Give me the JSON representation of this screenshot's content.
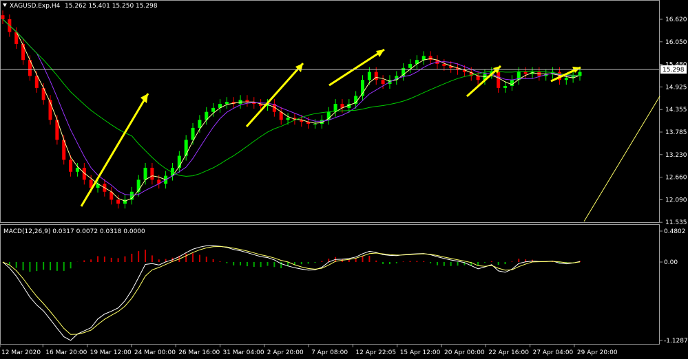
{
  "header": {
    "symbol_label": "XAGUSD.Exp,H4",
    "ohlc": "15.262 15.401 15.250 15.298"
  },
  "price_axis": {
    "ticks": [
      "16.620",
      "16.050",
      "15.480",
      "14.925",
      "14.355",
      "13.785",
      "13.230",
      "12.660",
      "12.090",
      "11.535"
    ],
    "current_price_label": "15.298"
  },
  "macd": {
    "label": "MACD(12,26,9) 0.0317 0.0072 0.0318 0.0000",
    "axis_ticks": [
      "0.4802",
      "0.00",
      "-1.1287"
    ]
  },
  "time_axis": {
    "labels": [
      "12 Mar 2020",
      "16 Mar 20:00",
      "19 Mar 12:00",
      "24 Mar 00:00",
      "26 Mar 16:00",
      "31 Mar 04:00",
      "2 Apr 20:00",
      "7 Apr 08:00",
      "12 Apr 22:05",
      "15 Apr 12:00",
      "20 Apr 00:00",
      "22 Apr 16:00",
      "27 Apr 04:00",
      "29 Apr 20:00"
    ]
  },
  "colors": {
    "bull_candle": "#00ff00",
    "bear_candle": "#ff0000",
    "arrow": "#ffff00",
    "ma_fast": "#ffff99",
    "ma_medium": "#9933ff",
    "ma_slow": "#00cc00",
    "macd_line": "#ffffff",
    "signal_line": "#ffff66",
    "hist_pos": "#cc0000",
    "hist_neg": "#00aa00"
  },
  "chart_data": {
    "type": "line",
    "close_prices": [
      16.62,
      16.3,
      16.0,
      15.6,
      15.2,
      14.9,
      14.6,
      14.1,
      13.6,
      13.1,
      12.8,
      12.9,
      12.6,
      12.4,
      12.5,
      12.3,
      12.1,
      12.0,
      12.1,
      12.3,
      12.6,
      12.9,
      12.6,
      12.5,
      12.7,
      12.9,
      13.2,
      13.6,
      13.9,
      14.1,
      14.3,
      14.4,
      14.5,
      14.55,
      14.5,
      14.6,
      14.55,
      14.5,
      14.45,
      14.5,
      14.3,
      14.1,
      14.15,
      14.1,
      14.05,
      14.0,
      14.0,
      14.1,
      14.3,
      14.5,
      14.4,
      14.5,
      14.7,
      15.1,
      15.3,
      15.1,
      15.0,
      15.1,
      15.2,
      15.4,
      15.5,
      15.6,
      15.7,
      15.6,
      15.5,
      15.45,
      15.4,
      15.35,
      15.3,
      15.2,
      15.1,
      15.25,
      15.3,
      14.9,
      14.95,
      15.1,
      15.3,
      15.25,
      15.3,
      15.2,
      15.25,
      15.3,
      15.1,
      15.15,
      15.2,
      15.3
    ]
  }
}
